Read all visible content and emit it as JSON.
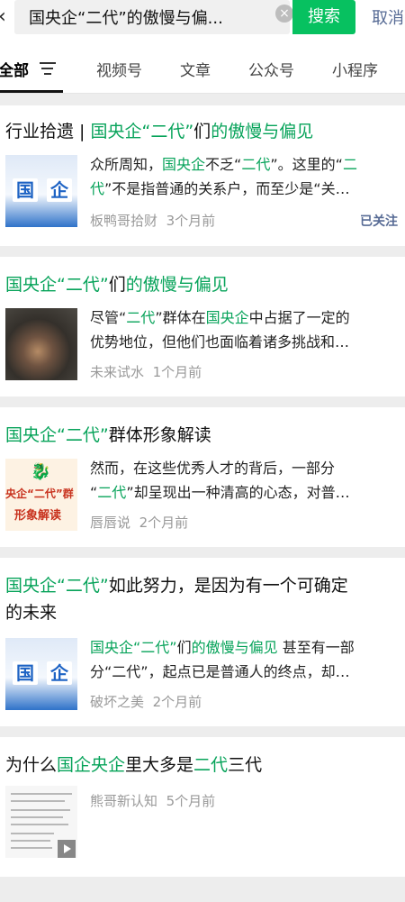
{
  "topbar": {
    "back_icon": "‹",
    "query": "国央企“二代”的傲慢与偏...",
    "search_button": "搜索",
    "cancel": "取消"
  },
  "tabs": [
    {
      "label": "全部"
    },
    {
      "label": "视频号"
    },
    {
      "label": "文章"
    },
    {
      "label": "公众号"
    },
    {
      "label": "小程序"
    }
  ],
  "results": [
    {
      "title": {
        "plain1": "行业拾遗 | ",
        "g1": "国央企“二代”",
        "plain2": "们",
        "g2": "的傲慢与偏见",
        "plain3": ""
      },
      "desc1": {
        "p1": "众所周知，",
        "g1": "国央企",
        "p2": "不乏“",
        "g2": "二代",
        "p3": "”。这里的“",
        "g3": "二"
      },
      "desc2": {
        "g1": "代",
        "p1": "”不是指普通的关系户，而至少是“关…"
      },
      "source": "板鸭哥拾财",
      "time": "3个月前",
      "follow": "已关注",
      "thumb_text": [
        "国",
        "企"
      ]
    },
    {
      "title": {
        "g1": "国央企“二代”",
        "plain1": "们",
        "g2": "的傲慢与偏见"
      },
      "desc1": {
        "p1": "尽管“",
        "g1": "二代",
        "p2": "”群体在",
        "g2": "国央企",
        "p3": "中占据了一定的"
      },
      "desc2": {
        "p1": "优势地位，但他们也面临着诸多挑战和…"
      },
      "source": "未来试水",
      "time": "1个月前"
    },
    {
      "title": {
        "g1": "国央企“二代”",
        "plain1": "群体形象解读"
      },
      "desc1": {
        "p1": "然而，在这些优秀人才的背后，一部分"
      },
      "desc2": {
        "p1": "“",
        "g1": "二代",
        "p2": "”却呈现出一种清高的心态，对普…"
      },
      "source": "唇唇说",
      "time": "2个月前",
      "thumb_text": [
        "央企“二代”群",
        "形象解读"
      ]
    },
    {
      "title1": {
        "g1": "国央企“二代”",
        "plain1": "如此努力，是因为有一个可确定"
      },
      "title2": "的未来",
      "desc1": {
        "g1": "国央企“二代”",
        "p1": "们",
        "g2": "的傲慢与偏见",
        "p2": " 甚至有一部"
      },
      "desc2": {
        "p1": "分“二代”，起点已是普通人的终点，却…"
      },
      "source": "破坏之美",
      "time": "2个月前",
      "thumb_text": [
        "国",
        "企"
      ]
    },
    {
      "title": {
        "plain1": "为什么",
        "g1": "国企央企",
        "plain2": "里大多是",
        "g2": "二代",
        "plain3": "三代"
      },
      "source": "熊哥新认知",
      "time": "5个月前"
    }
  ],
  "colors": {
    "accent": "#07c160",
    "highlight": "#07a35a",
    "link": "#576b95"
  }
}
